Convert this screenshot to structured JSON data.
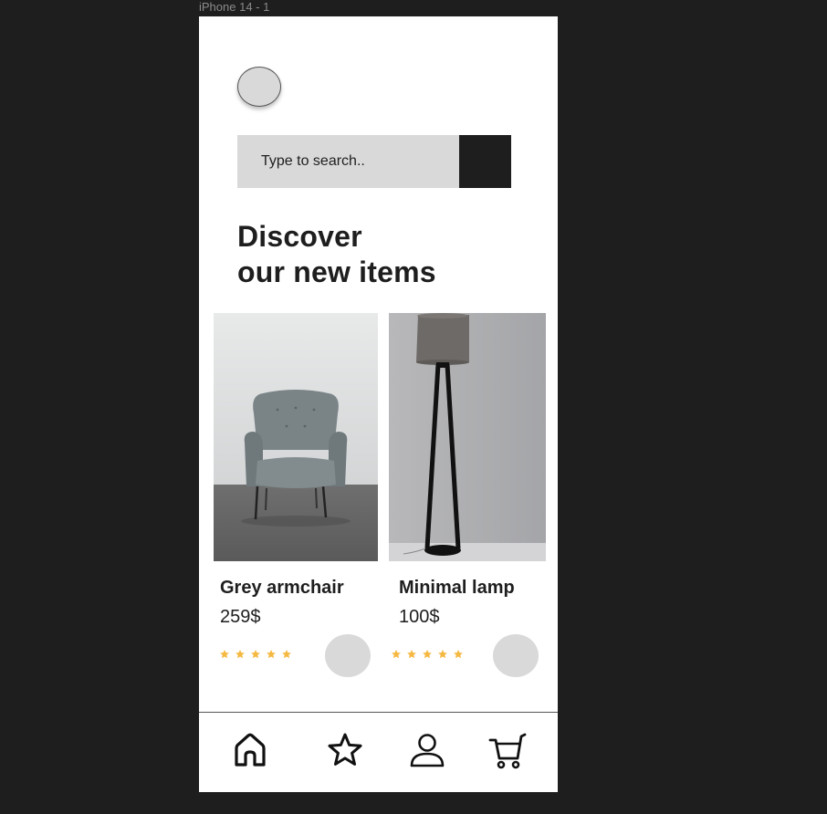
{
  "frame": {
    "label": "iPhone 14 - 1"
  },
  "search": {
    "placeholder": "Type to search.."
  },
  "headline": {
    "line1": "Discover",
    "line2": "our new items"
  },
  "products": [
    {
      "name": "Grey armchair",
      "price": "259$",
      "rating": 5
    },
    {
      "name": "Minimal lamp",
      "price": "100$",
      "rating": 5
    }
  ],
  "nav": {
    "items": [
      {
        "icon": "home-icon"
      },
      {
        "icon": "star-icon"
      },
      {
        "icon": "user-icon"
      },
      {
        "icon": "cart-icon"
      }
    ]
  },
  "colors": {
    "background": "#1e1e1e",
    "surface": "#ffffff",
    "placeholder_grey": "#d9d9d9",
    "text": "#1e1e1e",
    "star": "#f5b942"
  }
}
